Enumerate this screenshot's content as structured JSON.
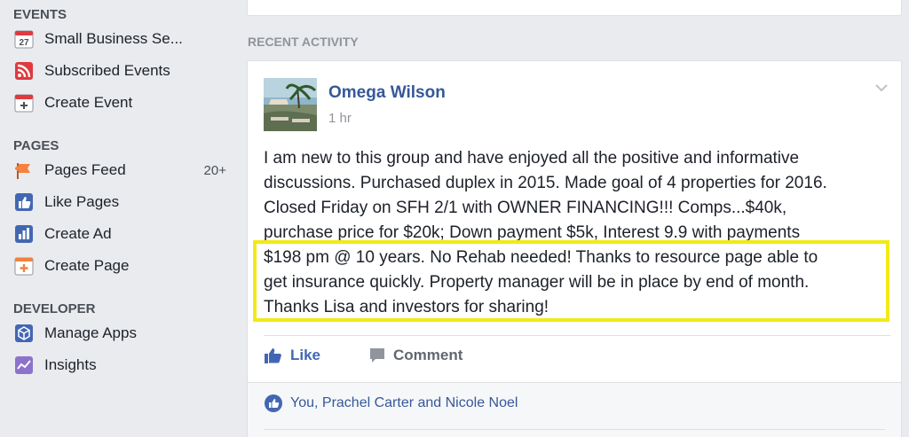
{
  "sidebar": {
    "events_title": "EVENTS",
    "events": [
      {
        "label": "Small Business Se...",
        "icon": "calendar-icon",
        "icon_text": "27"
      },
      {
        "label": "Subscribed Events",
        "icon": "rss-icon"
      },
      {
        "label": "Create Event",
        "icon": "create-event-icon"
      }
    ],
    "pages_title": "PAGES",
    "pages": [
      {
        "label": "Pages Feed",
        "icon": "flag-icon",
        "count": "20+"
      },
      {
        "label": "Like Pages",
        "icon": "thumbs-up-icon"
      },
      {
        "label": "Create Ad",
        "icon": "bar-chart-icon"
      },
      {
        "label": "Create Page",
        "icon": "create-page-icon"
      }
    ],
    "developer_title": "DEVELOPER",
    "developer": [
      {
        "label": "Manage Apps",
        "icon": "cube-icon"
      },
      {
        "label": "Insights",
        "icon": "line-chart-icon"
      }
    ]
  },
  "feed": {
    "section_title": "RECENT ACTIVITY",
    "post": {
      "author": "Omega Wilson",
      "time": "1 hr",
      "lines": [
        "I am new to this group and have enjoyed all the positive and informative",
        "discussions. Purchased duplex in 2015. Made goal of 4 properties for 2016.",
        "Closed Friday on SFH 2/1 with OWNER FINANCING!!! Comps...$40k,",
        "purchase price for $20k; Down payment $5k, Interest 9.9 with payments",
        "$198 pm @ 10 years. No Rehab needed! Thanks to resource page able to",
        "get insurance quickly. Property manager will be in place by end of month.",
        "Thanks Lisa and investors for sharing!"
      ],
      "like_label": "Like",
      "comment_label": "Comment",
      "reactions_text": "You, Prachel Carter and Nicole Noel"
    }
  },
  "colors": {
    "link_blue": "#365899",
    "like_blue": "#4267b2",
    "highlight_yellow": "#f2ea18",
    "page_bg": "#e9ebee"
  }
}
